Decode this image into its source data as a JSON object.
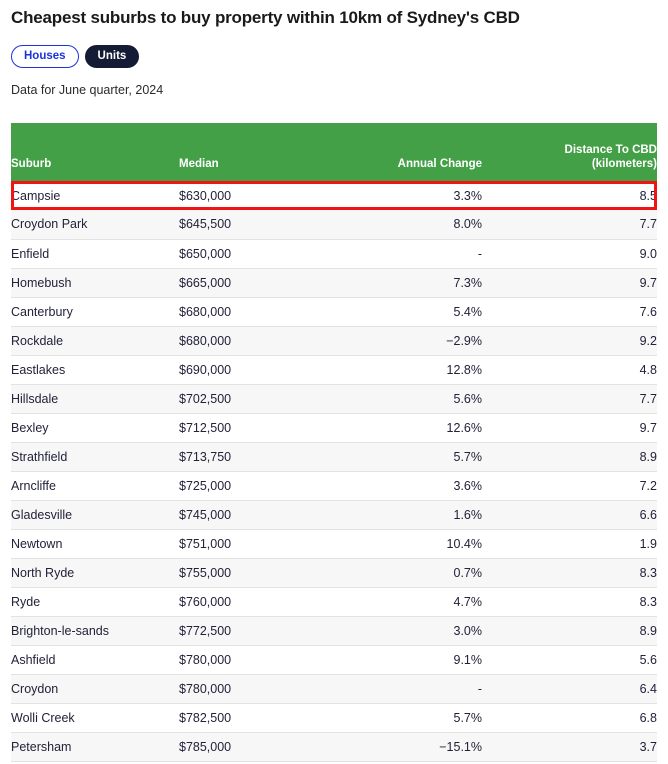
{
  "header": {
    "title": "Cheapest suburbs to buy property within 10km of Sydney's CBD",
    "note": "Data for June quarter, 2024"
  },
  "toggle": {
    "options": [
      {
        "label": "Houses",
        "selected": false
      },
      {
        "label": "Units",
        "selected": true
      }
    ]
  },
  "colors": {
    "header_green": "#43a047",
    "highlight_red": "#f01414",
    "pill_active_bg": "#141b34",
    "pill_inactive_text": "#1a34d8",
    "stripe": "#f7f7f7"
  },
  "table": {
    "columns": [
      {
        "label": "Suburb",
        "label2": ""
      },
      {
        "label": "Median",
        "label2": ""
      },
      {
        "label": "Annual Change",
        "label2": ""
      },
      {
        "label": "Distance To CBD",
        "label2": "(kilometers)"
      }
    ],
    "highlighted_row_index": 0,
    "rows": [
      {
        "suburb": "Campsie",
        "median": "$630,000",
        "change": "3.3%",
        "distance": "8.5"
      },
      {
        "suburb": "Croydon Park",
        "median": "$645,500",
        "change": "8.0%",
        "distance": "7.7"
      },
      {
        "suburb": "Enfield",
        "median": "$650,000",
        "change": "-",
        "distance": "9.0"
      },
      {
        "suburb": "Homebush",
        "median": "$665,000",
        "change": "7.3%",
        "distance": "9.7"
      },
      {
        "suburb": "Canterbury",
        "median": "$680,000",
        "change": "5.4%",
        "distance": "7.6"
      },
      {
        "suburb": "Rockdale",
        "median": "$680,000",
        "change": "−2.9%",
        "distance": "9.2"
      },
      {
        "suburb": "Eastlakes",
        "median": "$690,000",
        "change": "12.8%",
        "distance": "4.8"
      },
      {
        "suburb": "Hillsdale",
        "median": "$702,500",
        "change": "5.6%",
        "distance": "7.7"
      },
      {
        "suburb": "Bexley",
        "median": "$712,500",
        "change": "12.6%",
        "distance": "9.7"
      },
      {
        "suburb": "Strathfield",
        "median": "$713,750",
        "change": "5.7%",
        "distance": "8.9"
      },
      {
        "suburb": "Arncliffe",
        "median": "$725,000",
        "change": "3.6%",
        "distance": "7.2"
      },
      {
        "suburb": "Gladesville",
        "median": "$745,000",
        "change": "1.6%",
        "distance": "6.6"
      },
      {
        "suburb": "Newtown",
        "median": "$751,000",
        "change": "10.4%",
        "distance": "1.9"
      },
      {
        "suburb": "North Ryde",
        "median": "$755,000",
        "change": "0.7%",
        "distance": "8.3"
      },
      {
        "suburb": "Ryde",
        "median": "$760,000",
        "change": "4.7%",
        "distance": "8.3"
      },
      {
        "suburb": "Brighton-le-sands",
        "median": "$772,500",
        "change": "3.0%",
        "distance": "8.9"
      },
      {
        "suburb": "Ashfield",
        "median": "$780,000",
        "change": "9.1%",
        "distance": "5.6"
      },
      {
        "suburb": "Croydon",
        "median": "$780,000",
        "change": "-",
        "distance": "6.4"
      },
      {
        "suburb": "Wolli Creek",
        "median": "$782,500",
        "change": "5.7%",
        "distance": "6.8"
      },
      {
        "suburb": "Petersham",
        "median": "$785,000",
        "change": "−15.1%",
        "distance": "3.7"
      }
    ]
  }
}
